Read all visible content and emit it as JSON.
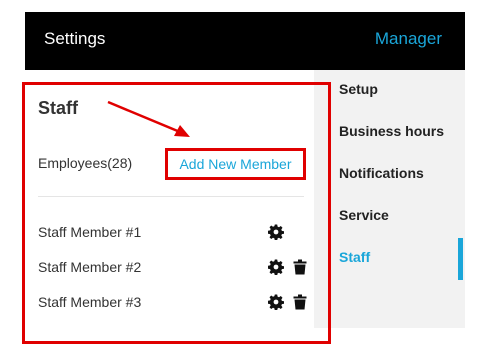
{
  "header": {
    "title": "Settings",
    "role": "Manager"
  },
  "colors": {
    "accent": "#1aa6d9",
    "highlight": "#e00000"
  },
  "sidebar": {
    "items": [
      {
        "label": "Setup"
      },
      {
        "label": "Business hours"
      },
      {
        "label": "Notifications"
      },
      {
        "label": "Service"
      },
      {
        "label": "Staff",
        "active": true
      }
    ]
  },
  "staff_panel": {
    "title": "Staff",
    "employees_label": "Employees(28)",
    "add_button_label": "Add New Member",
    "members": [
      {
        "name": "Staff Member #1",
        "icons": [
          "gear-icon"
        ]
      },
      {
        "name": "Staff Member #2",
        "icons": [
          "gear-icon",
          "trash-icon"
        ]
      },
      {
        "name": "Staff Member #3",
        "icons": [
          "gear-icon",
          "trash-icon"
        ]
      }
    ]
  }
}
